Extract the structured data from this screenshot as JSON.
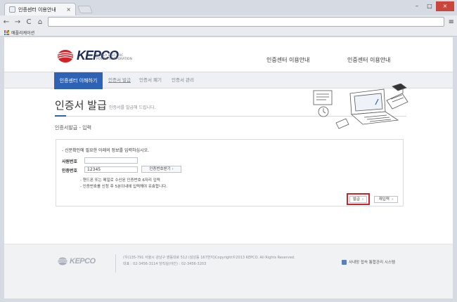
{
  "browser": {
    "tab_title": "인증센터 이용안내",
    "tab_close": "×",
    "window_buttons": {
      "minimize": "–",
      "maximize": "□",
      "close": "×"
    },
    "nav": {
      "back": "←",
      "forward": "→",
      "reload": "C",
      "home": "⌂"
    },
    "url": "",
    "menu": "≡",
    "bookmarks_label": "애플리케이션"
  },
  "header": {
    "logo_text": "KEPCO",
    "logo_sub": "KOREA ELECTRIC POWER CORPORATION",
    "gnb": [
      "인증센터 이용안내",
      "인증센터 이용안내"
    ]
  },
  "subnav": {
    "active": "인증센터 이해하기",
    "items": [
      "인증서 발급",
      "인증서 폐기",
      "인증서 관리"
    ]
  },
  "main": {
    "title": "인증서 발급",
    "subtitle": "인증서를 발급해 드립니다.",
    "breadcrumb": "인증서발급 - 입력"
  },
  "form": {
    "intro": "- 신분확인에 필요한 아래의 정보를 입력하십시오.",
    "employee_label": "사원번호",
    "employee_value": "",
    "auth_label": "인증번호",
    "auth_value": "12345",
    "get_code_label": "인증번호받기",
    "notes": [
      "- 핸드폰 또는 메일로 수신된 인증번호 6자리 입력",
      "- 인증번호를 신청 후 5분이내에 입력해야 유효합니다."
    ],
    "issue_button": "발급",
    "reenter_button": "재입력",
    "arrow": "›"
  },
  "footer": {
    "logo_text": "KEPCO",
    "address": "(우)135-791 서울시 강남구 영동대로 512 (삼성동 167번지)Copyright©2013 KEPCO. All Rights Reserved.",
    "phone": "대표 : 02-3456-3114 당직실(야간) : 02-3456-3203",
    "system_link": "사내망 접속 통합관리 시스템"
  },
  "colors": {
    "brand_blue": "#2d62b4",
    "logo_red": "#d42127",
    "highlight": "#d42127"
  }
}
